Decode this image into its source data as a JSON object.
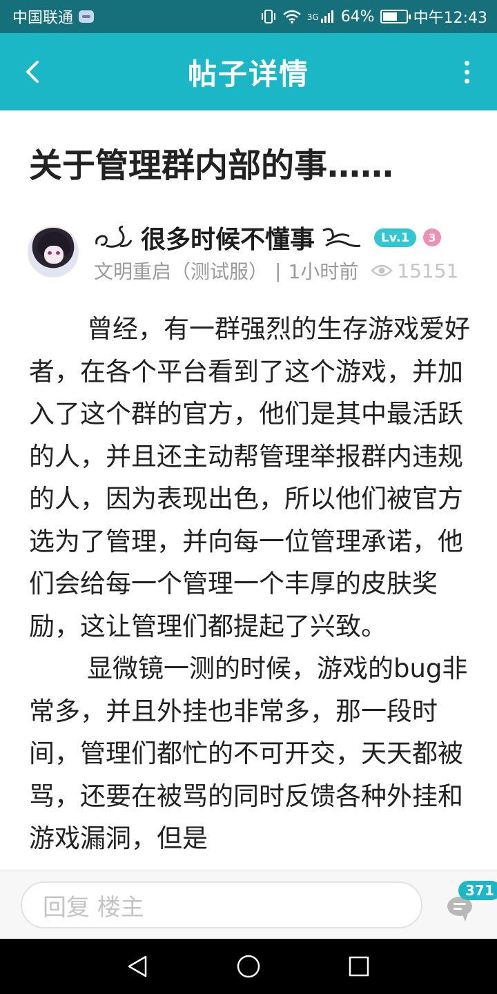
{
  "status_bar": {
    "carrier": "中国联通",
    "network": "3G",
    "battery": "64%",
    "battery_level": 0.64,
    "time": "中午12:43"
  },
  "header": {
    "title": "帖子详情"
  },
  "post": {
    "title": "关于管理群内部的事……",
    "author": {
      "name": "很多时候不懂事",
      "level": "Lv.1",
      "badge_number": "3"
    },
    "meta": {
      "server": "文明重启（测试服）",
      "separator": "|",
      "time": "1小时前",
      "views": "15151"
    },
    "body": [
      "曾经，有一群强烈的生存游戏爱好者，在各个平台看到了这个游戏，并加入了这个群的官方，他们是其中最活跃的人，并且还主动帮管理举报群内违规的人，因为表现出色，所以他们被官方选为了管理，并向每一位管理承诺，他们会给每一个管理一个丰厚的皮肤奖励，这让管理们都提起了兴致。",
      "显微镜一测的时候，游戏的bug非常多，并且外挂也非常多，那一段时间，管理们都忙的不可开交，天天都被骂，还要在被骂的同时反馈各种外挂和游戏漏洞，但是"
    ]
  },
  "reply_bar": {
    "placeholder": "回复  楼主",
    "comment_count": "371"
  },
  "icons": {
    "back": "back-arrow-icon",
    "more": "more-vertical-icon",
    "views": "eye-icon",
    "comment": "comment-bubble-icon",
    "nav_back": "nav-back-icon",
    "nav_home": "nav-home-icon",
    "nav_recent": "nav-recent-icon"
  },
  "colors": {
    "status_bar": "#15707c",
    "header": "#1cb7c6",
    "level_badge": "#30c7d1",
    "pink_badge": "#f08fb4"
  }
}
